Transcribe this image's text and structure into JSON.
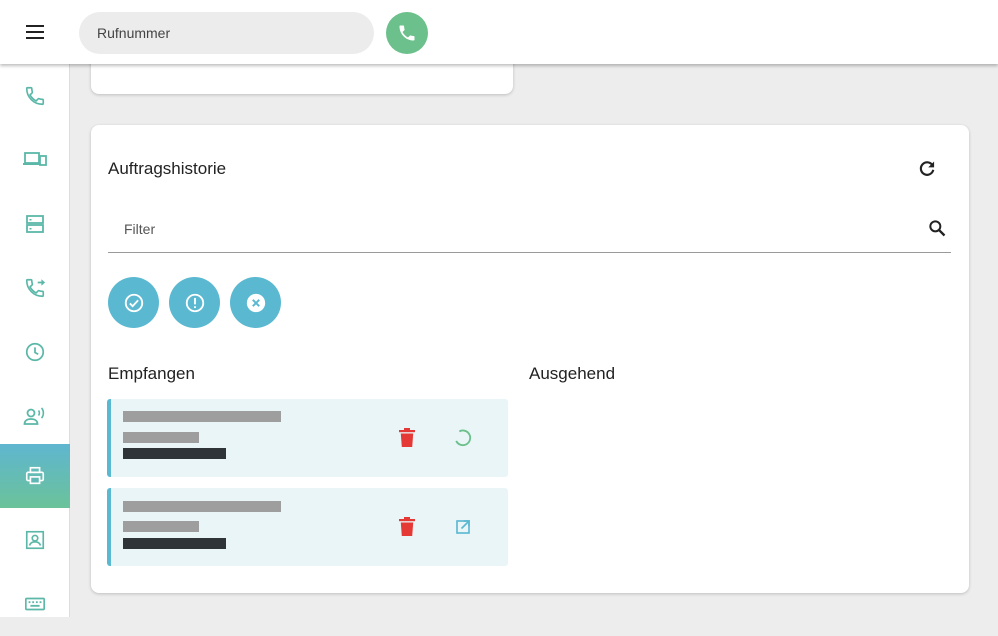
{
  "topbar": {
    "menu_icon": "hamburger-menu-icon",
    "search_placeholder": "Rufnummer",
    "call_icon": "phone-icon"
  },
  "sidebar": {
    "items": [
      {
        "icon": "phone-icon",
        "active": false
      },
      {
        "icon": "devices-icon",
        "active": false
      },
      {
        "icon": "server-icon",
        "active": false
      },
      {
        "icon": "call-forward-icon",
        "active": false
      },
      {
        "icon": "clock-icon",
        "active": false
      },
      {
        "icon": "voice-person-icon",
        "active": false
      },
      {
        "icon": "printer-icon",
        "active": true
      },
      {
        "icon": "contact-card-icon",
        "active": false
      },
      {
        "icon": "keyboard-icon",
        "active": false
      }
    ]
  },
  "card": {
    "title": "Auftragshistorie",
    "refresh_icon": "refresh-icon",
    "filter_placeholder": "Filter",
    "search_icon": "search-icon",
    "status_filters": [
      "check-circle-icon",
      "exclamation-circle-icon",
      "x-circle-icon"
    ],
    "col_received": "Empfangen",
    "col_outgoing": "Ausgehend",
    "received_jobs": [
      {
        "action_icon": "loading-spinner-icon"
      },
      {
        "action_icon": "open-external-icon"
      }
    ]
  },
  "colors": {
    "accent_blue": "#5bb8d1",
    "accent_green": "#6cc08b",
    "delete_red": "#e53935"
  }
}
